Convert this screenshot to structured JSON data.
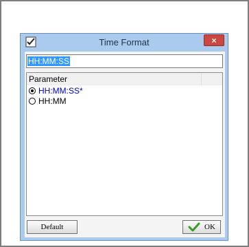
{
  "window": {
    "title": "Time Format",
    "close_label": "×"
  },
  "format_field": {
    "value": "HH:MM:SS"
  },
  "list": {
    "header": "Parameter",
    "items": [
      {
        "label": "HH:MM:SS*",
        "selected": true
      },
      {
        "label": "HH:MM",
        "selected": false
      }
    ]
  },
  "buttons": {
    "default_label": "Default",
    "ok_label": "OK"
  },
  "icons": {
    "app": "pencil-check-icon",
    "ok": "check-icon"
  },
  "colors": {
    "title_bar": "#aacbee",
    "close_button": "#c9483f",
    "selection": "#3399ff",
    "selected_item_text": "#0000cc",
    "ok_check": "#3a9a2a"
  }
}
